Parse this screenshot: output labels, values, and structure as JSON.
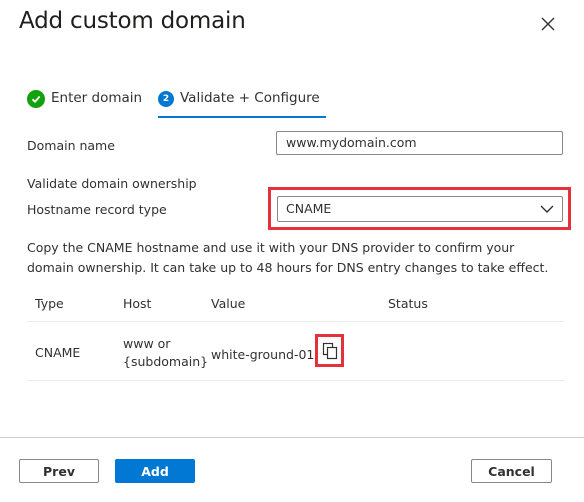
{
  "dialog": {
    "title": "Add custom domain"
  },
  "steps": [
    {
      "label": "Enter domain",
      "state": "complete",
      "icon": "check-icon"
    },
    {
      "label": "Validate + Configure",
      "state": "active",
      "number": "2"
    }
  ],
  "form": {
    "domain_name_label": "Domain name",
    "domain_name_value": "www.mydomain.com",
    "section_title": "Validate domain ownership",
    "record_type_label": "Hostname record type",
    "record_type_value": "CNAME"
  },
  "description": "Copy the CNAME hostname and use it with your DNS provider to confirm your domain ownership. It can take up to 48 hours for DNS entry changes to take effect.",
  "table": {
    "headers": [
      "Type",
      "Host",
      "Value",
      "Status"
    ],
    "rows": [
      {
        "type": "CNAME",
        "host_line1": "www or",
        "host_line2": "{subdomain}",
        "value": "white-ground-01..",
        "status": ""
      }
    ]
  },
  "footer": {
    "prev_label": "Prev",
    "add_label": "Add",
    "cancel_label": "Cancel"
  },
  "colors": {
    "accent": "#0078d4",
    "success": "#13a10e",
    "highlight": "#e3323b"
  }
}
